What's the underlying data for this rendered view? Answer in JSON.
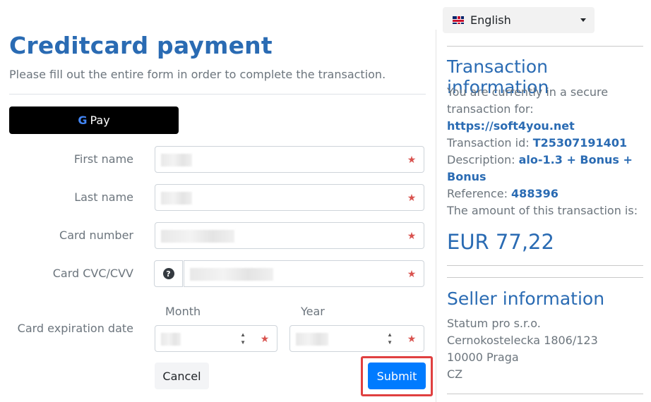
{
  "form": {
    "title": "Creditcard payment",
    "subtitle": "Please fill out the entire form in order to complete the transaction.",
    "gpay": {
      "g": "G",
      "pay": "Pay"
    },
    "required_marker": "★",
    "fields": {
      "first_name": "First name",
      "last_name": "Last name",
      "card_number": "Card number",
      "card_cvc": "Card CVC/CVV",
      "expiration": "Card expiration date",
      "month": "Month",
      "year": "Year"
    },
    "help_icon": "?",
    "cancel_label": "Cancel",
    "submit_label": "Submit"
  },
  "language": {
    "label": "English",
    "flag_icon": "uk-flag-icon"
  },
  "transaction": {
    "title": "Transaction information",
    "secure_text_1": "You are currently in a secure",
    "secure_text_2": "transaction for: ",
    "url": "https://soft4you.net",
    "id_label": "Transaction id: ",
    "id_value": "T25307191401",
    "desc_label": "Description: ",
    "desc_value_1": "alo-1.3 + Bonus +",
    "desc_value_2": "Bonus",
    "ref_label": "Reference: ",
    "ref_value": "488396",
    "amount_label": "The amount of this transaction is:",
    "amount": "EUR 77,22"
  },
  "seller": {
    "title": "Seller information",
    "name": "Statum pro s.r.o.",
    "street": "Cernokostelecka 1806/123",
    "city": "10000 Praga",
    "country": "CZ"
  }
}
